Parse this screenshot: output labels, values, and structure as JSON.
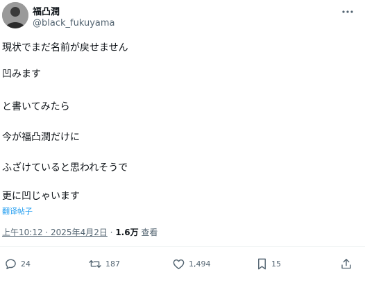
{
  "author": {
    "display_name": "福凸潤",
    "handle": "@black_fukuyama",
    "avatar_icon": "avatar"
  },
  "tweet": {
    "lines": [
      "現状でまだ名前が戻せません",
      "凹みます",
      "と書いてみたら",
      "今が福凸潤だけに",
      "ふざけていると思われそうで",
      "更に凹じゃいます"
    ],
    "translate_label": "翻译帖子"
  },
  "meta": {
    "timestamp": "上午10:12 · 2025年4月2日",
    "separator": "·",
    "views_count": "1.6万",
    "views_label": "查看"
  },
  "actions": {
    "reply_count": "24",
    "retweet_count": "187",
    "like_count": "1,494",
    "bookmark_count": "15"
  },
  "colors": {
    "text": "#0f1419",
    "secondary": "#536471",
    "link": "#1d9bf0"
  }
}
